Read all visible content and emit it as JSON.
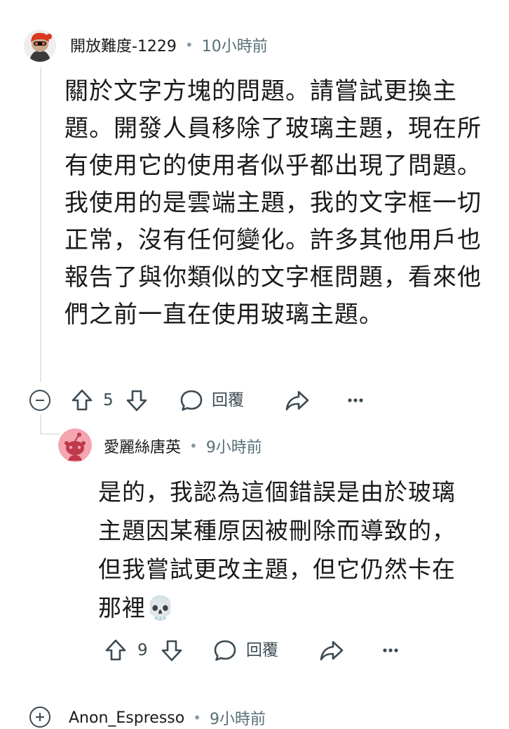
{
  "comments": [
    {
      "author": "開放難度-1229",
      "separator": "•",
      "time": "10小時前",
      "body": "關於文字方塊的問題。請嘗試更換主題。開發人員移除了玻璃主題，現在所有使用它的使用者似乎都出現了問題。我使用的是雲端主題，我的文字框一切正常，沒有任何變化。許多其他用戶也報告了與你類似的文字框問題，看來他們之前一直在使用玻璃主題。",
      "upvotes": "5",
      "reply_label": "回覆"
    },
    {
      "author": "愛麗絲唐英",
      "separator": "•",
      "time": "9小時前",
      "body": "是的，我認為這個錯誤是由於玻璃主題因某種原因被刪除而導致的，但我嘗試更改主題，但它仍然卡在那裡💀",
      "upvotes": "9",
      "reply_label": "回覆"
    },
    {
      "author": "Anon_Espresso",
      "separator": "•",
      "time": "9小時前"
    }
  ]
}
